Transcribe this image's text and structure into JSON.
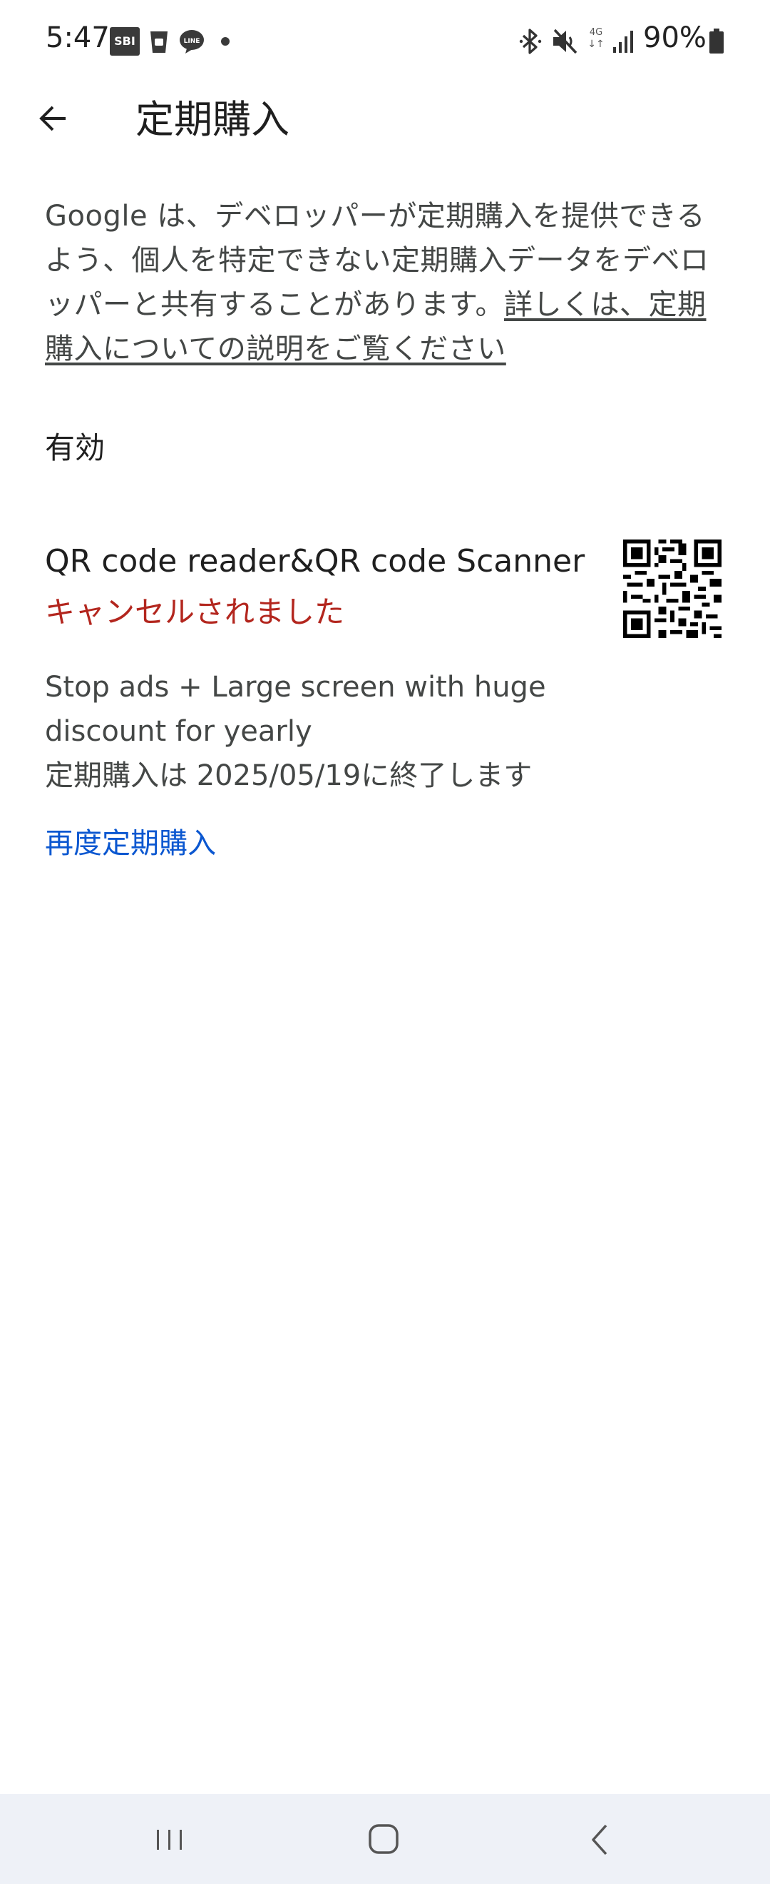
{
  "status_bar": {
    "time": "5:47",
    "notif_sbi": "SBI",
    "notif_line": "LINE",
    "network_type": "4G",
    "battery": "90%"
  },
  "header": {
    "title": "定期購入"
  },
  "description": {
    "text": "Google は、デベロッパーが定期購入を提供できるよう、個人を特定できない定期購入データをデベロッパーと共有することがあります。",
    "link": "詳しくは、定期購入についての説明をご覧ください"
  },
  "section": {
    "active_label": "有効"
  },
  "subscription": {
    "app_name": "QR code reader&QR code Scanner",
    "status": "キャンセルされました",
    "plan_description": "Stop ads + Large screen with huge discount for yearly",
    "end_date_text": "定期購入は 2025/05/19に終了します",
    "resubscribe_label": "再度定期購入",
    "icon": "qr-code-icon"
  },
  "colors": {
    "cancel_status": "#b3261e",
    "link_blue": "#0b57d0",
    "nav_bg": "#eef1f7"
  },
  "nav_bar": {
    "recents_icon": "recents-icon",
    "home_icon": "home-icon",
    "back_icon": "back-icon"
  }
}
